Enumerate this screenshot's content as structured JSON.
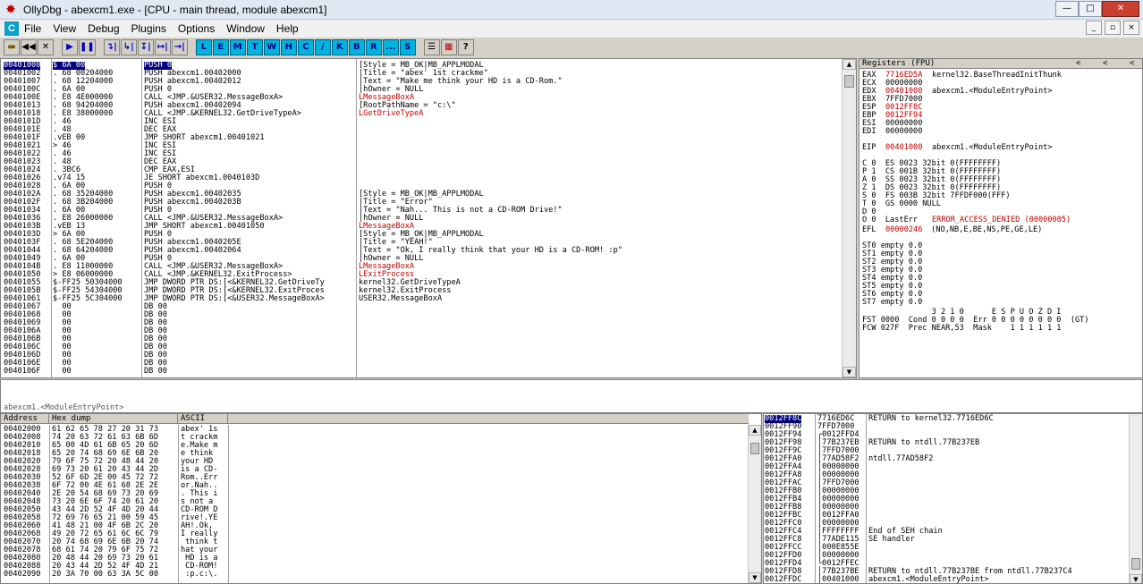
{
  "window": {
    "title": "OllyDbg - abexcm1.exe - [CPU - main thread, module abexcm1]",
    "minimize": "—",
    "maximize": "□",
    "close": "✕"
  },
  "menu": [
    "File",
    "View",
    "Debug",
    "Plugins",
    "Options",
    "Window",
    "Help"
  ],
  "mdi": [
    "_",
    "▫",
    "×"
  ],
  "toolbar": {
    "left": [
      "open-icon",
      "restart-icon",
      "close-icon"
    ],
    "run": [
      "▶",
      "❚❚"
    ],
    "trace": [
      "↴|",
      "↳|",
      "↧|",
      "↦|",
      "→|"
    ],
    "letters": [
      "L",
      "E",
      "M",
      "T",
      "W",
      "H",
      "C",
      "/",
      "K",
      "B",
      "R",
      "...",
      "S"
    ],
    "right": [
      "☰",
      "▦",
      "?"
    ]
  },
  "disasm": {
    "addresses": [
      "00401000",
      "00401002",
      "00401007",
      "0040100C",
      "0040100E",
      "00401013",
      "00401018",
      "0040101D",
      "0040101E",
      "0040101F",
      "00401021",
      "00401022",
      "00401023",
      "00401024",
      "00401026",
      "00401028",
      "0040102A",
      "0040102F",
      "00401034",
      "00401036",
      "0040103B",
      "0040103D",
      "0040103F",
      "00401044",
      "00401049",
      "0040104B",
      "00401050",
      "00401055",
      "0040105B",
      "00401061",
      "00401067",
      "00401068",
      "00401069",
      "0040106A",
      "0040106B",
      "0040106C",
      "0040106D",
      "0040106E",
      "0040106F"
    ],
    "hex": [
      "$ 6A 00",
      ". 68 00204000",
      ". 68 12204000",
      ". 6A 00",
      ". E8 4E000000",
      ". 68 94204000",
      ". E8 38000000",
      ". 46",
      ". 48",
      ".vEB 00",
      "> 46",
      ". 46",
      ". 48",
      ". 3BC6",
      ".v74 15",
      ". 6A 00",
      ". 68 35204000",
      ". 68 3B204000",
      ". 6A 00",
      ". E8 26000000",
      ".vEB 13",
      "> 6A 00",
      ". 68 5E204000",
      ". 68 64204000",
      ". 6A 00",
      ". E8 11000000",
      "> E8 06000000",
      "$-FF25 50304000",
      "$-FF25 54304000",
      "$-FF25 5C304000",
      "  00",
      "  00",
      "  00",
      "  00",
      "  00",
      "  00",
      "  00",
      "  00",
      "  00"
    ],
    "instr": [
      "PUSH 0",
      "PUSH abexcm1.00402000",
      "PUSH abexcm1.00402012",
      "PUSH 0",
      "CALL <JMP.&USER32.MessageBoxA>",
      "PUSH abexcm1.00402094",
      "CALL <JMP.&KERNEL32.GetDriveTypeA>",
      "INC ESI",
      "DEC EAX",
      "JMP SHORT abexcm1.00401021",
      "INC ESI",
      "INC ESI",
      "DEC EAX",
      "CMP EAX,ESI",
      "JE SHORT abexcm1.0040103D",
      "PUSH 0",
      "PUSH abexcm1.00402035",
      "PUSH abexcm1.0040203B",
      "PUSH 0",
      "CALL <JMP.&USER32.MessageBoxA>",
      "JMP SHORT abexcm1.00401050",
      "PUSH 0",
      "PUSH abexcm1.0040205E",
      "PUSH abexcm1.00402064",
      "PUSH 0",
      "CALL <JMP.&USER32.MessageBoxA>",
      "CALL <JMP.&KERNEL32.ExitProcess>",
      "JMP DWORD PTR DS:[<&KERNEL32.GetDriveTy",
      "JMP DWORD PTR DS:[<&KERNEL32.ExitProces",
      "JMP DWORD PTR DS:[<&USER32.MessageBoxA>",
      "DB 00",
      "DB 00",
      "DB 00",
      "DB 00",
      "DB 00",
      "DB 00",
      "DB 00",
      "DB 00",
      "DB 00"
    ],
    "comments": [
      "[Style = MB_OK|MB_APPLMODAL",
      "|Title = \"abex' 1st crackme\"",
      "|Text = \"Make me think your HD is a CD-Rom.\"",
      "|hOwner = NULL",
      "LMessageBoxA",
      "[RootPathName = \"c:\\\"",
      "LGetDriveTypeA",
      "",
      "",
      "",
      "",
      "",
      "",
      "",
      "",
      "",
      "[Style = MB_OK|MB_APPLMODAL",
      "|Title = \"Error\"",
      "|Text = \"Nah... This is not a CD-ROM Drive!\"",
      "|hOwner = NULL",
      "LMessageBoxA",
      "[Style = MB_OK|MB_APPLMODAL",
      "|Title = \"YEAH!\"",
      "|Text = \"Ok, I really think that your HD is a CD-ROM! :p\"",
      "|hOwner = NULL",
      "LMessageBoxA",
      "LExitProcess",
      "kernel32.GetDriveTypeA",
      "kernel32.ExitProcess",
      "USER32.MessageBoxA",
      "",
      "",
      "",
      "",
      "",
      "",
      "",
      "",
      ""
    ]
  },
  "info_line": "abexcm1.<ModuleEntryPoint>",
  "registers": {
    "header": "Registers (FPU)",
    "lines": [
      {
        "name": "EAX",
        "val": "7716ED5A",
        "desc": "kernel32.BaseThreadInitThunk",
        "red": true
      },
      {
        "name": "ECX",
        "val": "00000000",
        "desc": "",
        "red": false
      },
      {
        "name": "EDX",
        "val": "00401000",
        "desc": "abexcm1.<ModuleEntryPoint>",
        "red": true
      },
      {
        "name": "EBX",
        "val": "7FFD7000",
        "desc": "",
        "red": false
      },
      {
        "name": "ESP",
        "val": "0012FF8C",
        "desc": "",
        "red": true
      },
      {
        "name": "EBP",
        "val": "0012FF94",
        "desc": "",
        "red": true
      },
      {
        "name": "ESI",
        "val": "00000000",
        "desc": "",
        "red": false
      },
      {
        "name": "EDI",
        "val": "00000000",
        "desc": "",
        "red": false
      }
    ],
    "eip": {
      "name": "EIP",
      "val": "00401000",
      "desc": "abexcm1.<ModuleEntryPoint>"
    },
    "flags": [
      "C 0  ES 0023 32bit 0(FFFFFFFF)",
      "P 1  CS 001B 32bit 0(FFFFFFFF)",
      "A 0  SS 0023 32bit 0(FFFFFFFF)",
      "Z 1  DS 0023 32bit 0(FFFFFFFF)",
      "S 0  FS 003B 32bit 7FFDF000(FFF)",
      "T 0  GS 0000 NULL",
      "D 0"
    ],
    "lasterr": {
      "prefix": "O 0  LastErr ",
      "val": "ERROR_ACCESS_DENIED (00000005)"
    },
    "efl": {
      "prefix": "EFL ",
      "val": "00000246",
      "desc": " (NO,NB,E,BE,NS,PE,GE,LE)"
    },
    "st": [
      "ST0 empty 0.0",
      "ST1 empty 0.0",
      "ST2 empty 0.0",
      "ST3 empty 0.0",
      "ST4 empty 0.0",
      "ST5 empty 0.0",
      "ST6 empty 0.0",
      "ST7 empty 0.0"
    ],
    "fpu": [
      "               3 2 1 0      E S P U O Z D I",
      "FST 0000  Cond 0 0 0 0  Err 0 0 0 0 0 0 0 0  (GT)",
      "FCW 027F  Prec NEAR,53  Mask    1 1 1 1 1 1"
    ]
  },
  "dump": {
    "headers": [
      "Address",
      "Hex dump",
      "ASCII"
    ],
    "addr": [
      "00402000",
      "00402008",
      "00402010",
      "00402018",
      "00402020",
      "00402028",
      "00402030",
      "00402038",
      "00402040",
      "00402048",
      "00402050",
      "00402058",
      "00402060",
      "00402068",
      "00402070",
      "00402078",
      "00402080",
      "00402088",
      "00402090"
    ],
    "hex": [
      "61 62 65 78 27 20 31 73",
      "74 20 63 72 61 63 6B 6D",
      "65 00 4D 61 6B 65 20 6D",
      "65 20 74 68 69 6E 6B 20",
      "79 6F 75 72 20 48 44 20",
      "69 73 20 61 20 43 44 2D",
      "52 6F 6D 2E 00 45 72 72",
      "6F 72 00 4E 61 68 2E 2E",
      "2E 20 54 68 69 73 20 69",
      "73 20 6E 6F 74 20 61 20",
      "43 44 2D 52 4F 4D 20 44",
      "72 69 76 65 21 00 59 45",
      "41 48 21 00 4F 6B 2C 20",
      "49 20 72 65 61 6C 6C 79",
      "20 74 68 69 6E 6B 20 74",
      "68 61 74 20 79 6F 75 72",
      "20 48 44 20 69 73 20 61",
      "20 43 44 2D 52 4F 4D 21",
      "20 3A 70 00 63 3A 5C 00"
    ],
    "ascii": [
      "abex' 1s",
      "t crackm",
      "e.Make m",
      "e think ",
      "your HD ",
      "is a CD-",
      "Rom..Err",
      "or.Nah..",
      ". This i",
      "s not a ",
      "CD-ROM D",
      "rive!.YE",
      "AH!.Ok, ",
      "I really",
      " think t",
      "hat your",
      " HD is a",
      " CD-ROM!",
      " :p.c:\\."
    ]
  },
  "stack": {
    "addr": [
      "0012FF8C",
      "0012FF90",
      "0012FF94",
      "0012FF98",
      "0012FF9C",
      "0012FFA0",
      "0012FFA4",
      "0012FFA8",
      "0012FFAC",
      "0012FFB0",
      "0012FFB4",
      "0012FFB8",
      "0012FFBC",
      "0012FFC0",
      "0012FFC4",
      "0012FFC8",
      "0012FFCC",
      "0012FFD0",
      "0012FFD4",
      "0012FFD8",
      "0012FFDC"
    ],
    "val": [
      "7716ED6C",
      "7FFD7000",
      "┌0012FFD4",
      "│77B237EB",
      "│7FFD7000",
      "│77AD58F2",
      "│00000000",
      "│00000000",
      "│7FFD7000",
      "│00000000",
      "│00000000",
      "│00000000",
      "│0012FFA0",
      "│00000000",
      "│FFFFFFFF",
      "│77ADE115",
      "│000E855E",
      "│00000000",
      "└0012FFEC",
      "│77B237BE",
      "│00401000"
    ],
    "comment": [
      "RETURN to kernel32.7716ED6C",
      "",
      "",
      "RETURN to ntdll.77B237EB",
      "",
      "ntdll.77AD58F2",
      "",
      "",
      "",
      "",
      "",
      "",
      "",
      "",
      "End of SEH chain",
      "SE handler",
      "",
      "",
      "",
      "RETURN to ntdll.77B237BE from ntdll.77B237C4",
      "abexcm1.<ModuleEntryPoint>"
    ]
  }
}
